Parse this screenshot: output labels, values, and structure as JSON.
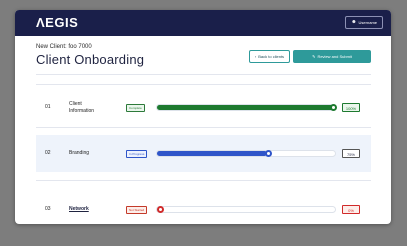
{
  "app": {
    "logo": "ΛEGIS",
    "user_button": "Username"
  },
  "header": {
    "subtitle": "New Client: foo 7000",
    "title": "Client Onboarding",
    "back_label": "Back to clients",
    "review_label": "Review and Submit"
  },
  "steps": [
    {
      "num": "01",
      "name_line1": "Client",
      "name_line2": "Information",
      "status": "Complete",
      "progress": 1.0,
      "percent": "100%",
      "color": "#1d7a2f"
    },
    {
      "num": "02",
      "name_line1": "Branding",
      "name_line2": "",
      "status": "In Progress",
      "progress": 0.65,
      "percent": "75%",
      "color": "#2f55c9"
    },
    {
      "num": "03",
      "name_line1": "Network",
      "name_line2": "",
      "status": "Not Started",
      "progress": 0.0,
      "percent": "0%",
      "color": "#d12a2a"
    }
  ],
  "icons": {
    "user": "user-icon",
    "back": "chevron-left-icon",
    "review": "edit-icon"
  }
}
